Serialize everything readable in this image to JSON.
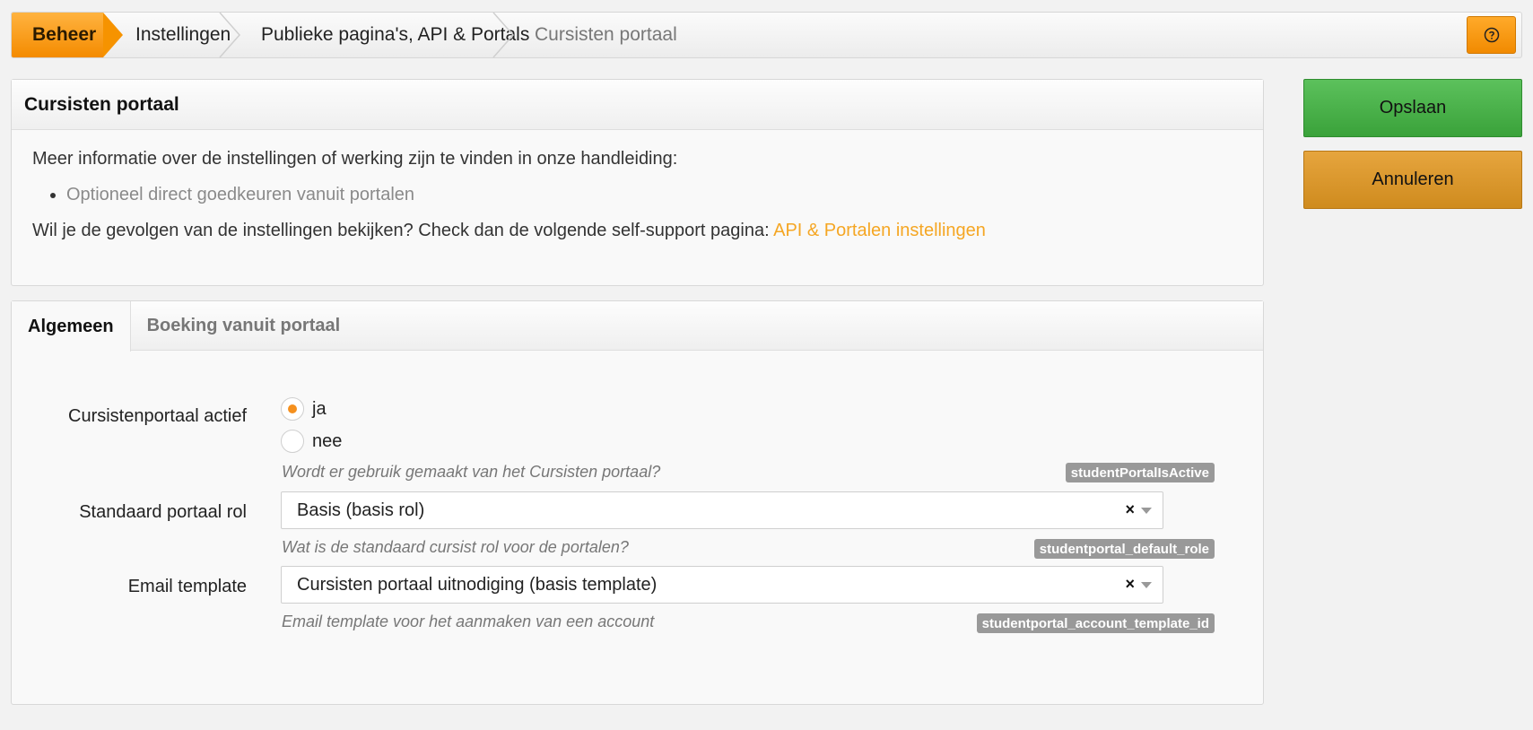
{
  "breadcrumb": {
    "items": [
      "Beheer",
      "Instellingen",
      "Publieke pagina's, API & Portals",
      "Cursisten portaal"
    ]
  },
  "help_button": {
    "icon": "question-circle-icon"
  },
  "info": {
    "title": "Cursisten portaal",
    "intro": "Meer informatie over de instellingen of werking zijn te vinden in onze handleiding:",
    "bullet_link": "Optioneel direct goedkeuren vanuit portalen",
    "support_text": "Wil je de gevolgen van de instellingen bekijken? Check dan de volgende self-support pagina:",
    "support_link": "API & Portalen instellingen"
  },
  "tabs": [
    {
      "label": "Algemeen",
      "active": true
    },
    {
      "label": "Boeking vanuit portaal",
      "active": false
    }
  ],
  "form": {
    "portal_active": {
      "label": "Cursistenportaal actief",
      "options": [
        "ja",
        "nee"
      ],
      "selected": "ja",
      "help": "Wordt er gebruik gemaakt van het Cursisten portaal?",
      "tag": "studentPortalIsActive"
    },
    "default_role": {
      "label": "Standaard portaal rol",
      "value": "Basis (basis rol)",
      "help": "Wat is de standaard cursist rol voor de portalen?",
      "tag": "studentportal_default_role"
    },
    "email_template": {
      "label": "Email template",
      "value": "Cursisten portaal uitnodiging (basis template)",
      "help": "Email template voor het aanmaken van een account",
      "tag": "studentportal_account_template_id"
    },
    "clear_symbol": "×"
  },
  "actions": {
    "save": "Opslaan",
    "cancel": "Annuleren"
  },
  "colors": {
    "accent": "#f5901e",
    "save": "#3aa23a",
    "cancel": "#cf8b1e"
  }
}
